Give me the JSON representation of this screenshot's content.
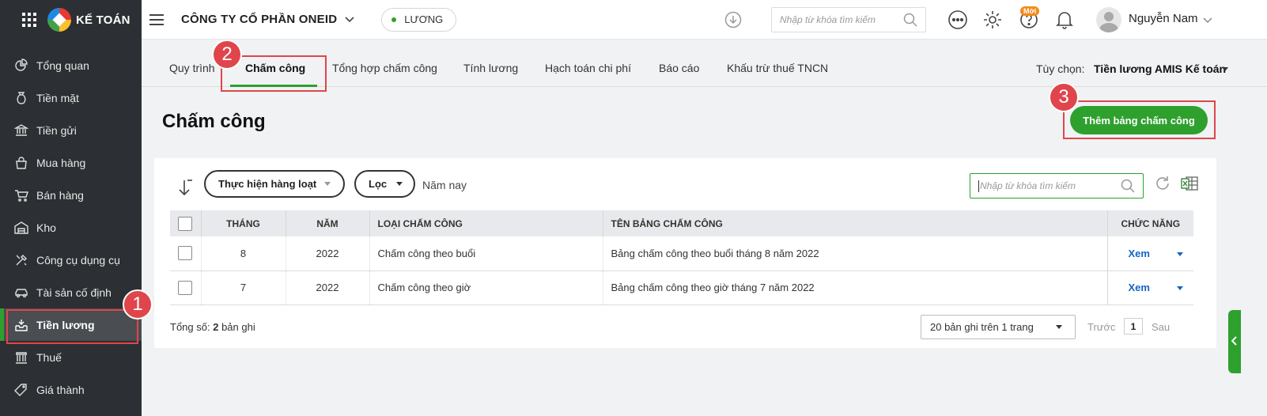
{
  "app": {
    "logo_text": "KẾ TOÁN"
  },
  "sidebar": {
    "items": [
      {
        "label": "Tổng quan",
        "icon": "pie-chart-icon"
      },
      {
        "label": "Tiền mặt",
        "icon": "money-bag-icon"
      },
      {
        "label": "Tiền gửi",
        "icon": "bank-icon"
      },
      {
        "label": "Mua hàng",
        "icon": "shopping-bag-icon"
      },
      {
        "label": "Bán hàng",
        "icon": "cart-icon"
      },
      {
        "label": "Kho",
        "icon": "warehouse-icon"
      },
      {
        "label": "Công cụ dụng cụ",
        "icon": "tools-icon"
      },
      {
        "label": "Tài sản cố định",
        "icon": "car-icon"
      },
      {
        "label": "Tiền lương",
        "icon": "payroll-tray-icon",
        "active": true
      },
      {
        "label": "Thuế",
        "icon": "tax-building-icon"
      },
      {
        "label": "Giá thành",
        "icon": "price-tag-icon"
      }
    ]
  },
  "header": {
    "company": "CÔNG TY CỔ PHẦN ONEID",
    "module": "LƯƠNG",
    "search_placeholder": "Nhập từ khóa tìm kiếm",
    "new_badge": "Mới",
    "user_name": "Nguyễn Nam"
  },
  "tabs": {
    "items": [
      "Quy trình",
      "Chấm công",
      "Tổng hợp chấm công",
      "Tính lương",
      "Hạch toán chi phí",
      "Báo cáo",
      "Khấu trừ thuế TNCN"
    ],
    "active_index": 1,
    "option_label": "Tùy chọn:",
    "option_value": "Tiền lương AMIS Kế toán"
  },
  "page": {
    "title": "Chấm công",
    "add_button": "Thêm bảng chấm công"
  },
  "badges": {
    "b1": "1",
    "b2": "2",
    "b3": "3"
  },
  "toolbar": {
    "bulk_action": "Thực hiện hàng loạt",
    "filter": "Lọc",
    "period": "Năm nay",
    "search_placeholder": "Nhập từ khóa tìm kiếm"
  },
  "table": {
    "headers": [
      "THÁNG",
      "NĂM",
      "LOẠI CHẤM CÔNG",
      "TÊN BẢNG CHẤM CÔNG",
      "CHỨC NĂNG"
    ],
    "rows": [
      {
        "month": "8",
        "year": "2022",
        "type": "Chấm công theo buổi",
        "name": "Bảng chấm công theo buổi tháng 8 năm 2022",
        "action": "Xem"
      },
      {
        "month": "7",
        "year": "2022",
        "type": "Chấm công theo giờ",
        "name": "Bảng chấm công theo giờ tháng 7 năm 2022",
        "action": "Xem"
      }
    ]
  },
  "footer": {
    "total_prefix": "Tổng số:",
    "total_count": "2",
    "total_suffix": "bản ghi",
    "page_size": "20 bản ghi trên 1 trang",
    "prev": "Trước",
    "page": "1",
    "next": "Sau"
  },
  "colors": {
    "accent": "#2ea02e",
    "highlight": "#e0454c",
    "sidebar_bg": "#2c2f33",
    "link": "#1565c0"
  }
}
